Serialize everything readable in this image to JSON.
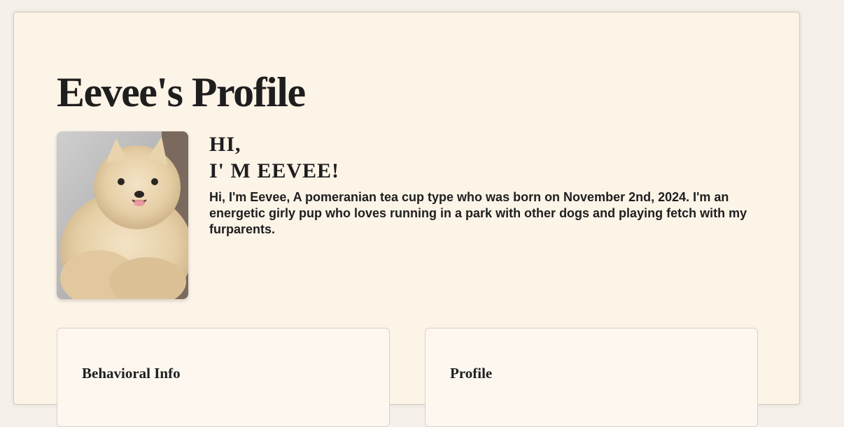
{
  "page": {
    "title": "Eevee's Profile"
  },
  "intro": {
    "greeting_line1": "HI,",
    "greeting_line2": "I' M EEVEE!",
    "bio": "Hi, I'm Eevee, A pomeranian tea cup type who was born on November 2nd, 2024. I'm an energetic girly pup who loves running in a park with other dogs and playing fetch with my furparents."
  },
  "photo": {
    "alt": "Eevee the pomeranian puppy"
  },
  "panels": [
    {
      "heading": "Behavioral Info"
    },
    {
      "heading": "Profile"
    }
  ],
  "colors": {
    "background": "#f6f0ea",
    "card": "#fdf4e8",
    "text": "#1e1e1e"
  }
}
